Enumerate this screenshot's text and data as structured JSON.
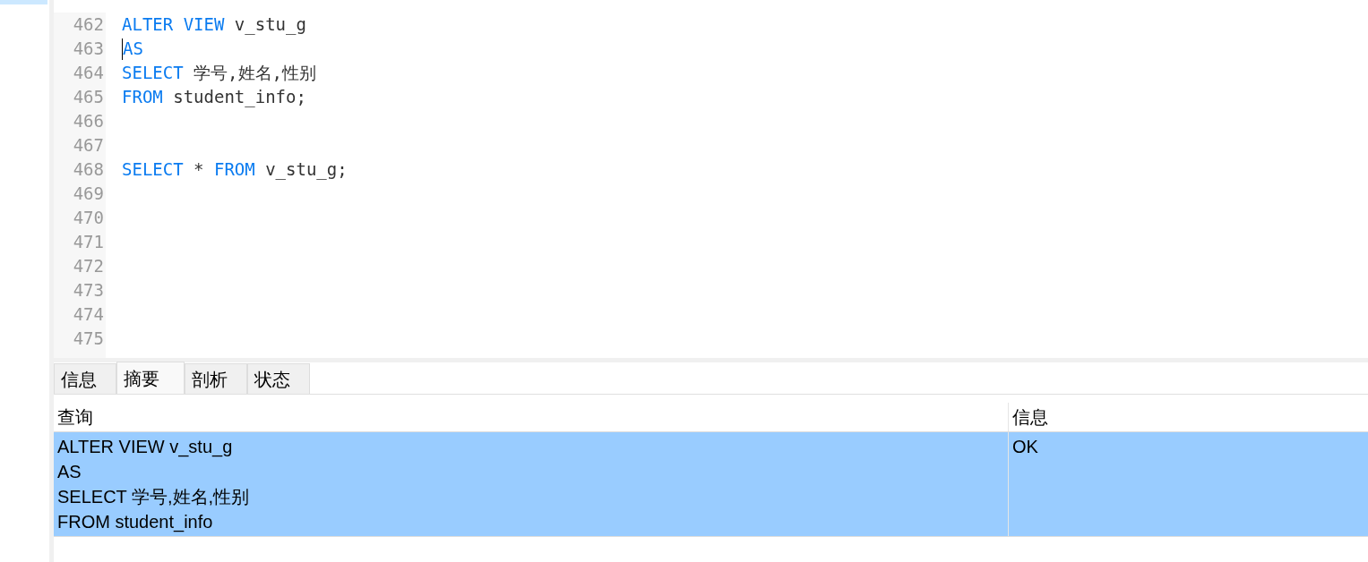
{
  "editor": {
    "lines": [
      {
        "number": "462",
        "tokens": [
          {
            "kind": "keyword",
            "text": "ALTER VIEW"
          },
          {
            "kind": "plain",
            "text": " v_stu_g"
          }
        ]
      },
      {
        "number": "463",
        "tokens": [
          {
            "kind": "cursor"
          },
          {
            "kind": "keyword",
            "text": "AS"
          }
        ]
      },
      {
        "number": "464",
        "tokens": [
          {
            "kind": "keyword",
            "text": "SELECT"
          },
          {
            "kind": "plain",
            "text": " 学号,姓名,性别"
          }
        ]
      },
      {
        "number": "465",
        "tokens": [
          {
            "kind": "keyword",
            "text": "FROM"
          },
          {
            "kind": "plain",
            "text": " student_info;"
          }
        ]
      },
      {
        "number": "466"
      },
      {
        "number": "467"
      },
      {
        "number": "468",
        "tokens": [
          {
            "kind": "keyword",
            "text": "SELECT"
          },
          {
            "kind": "plain",
            "text": " * "
          },
          {
            "kind": "keyword",
            "text": "FROM"
          },
          {
            "kind": "plain",
            "text": " v_stu_g;"
          }
        ]
      },
      {
        "number": "469"
      },
      {
        "number": "470"
      },
      {
        "number": "471"
      },
      {
        "number": "472"
      },
      {
        "number": "473"
      },
      {
        "number": "474"
      },
      {
        "number": "475"
      }
    ]
  },
  "result_tabs": [
    {
      "label": "信息",
      "selected": false
    },
    {
      "label": "摘要",
      "selected": true
    },
    {
      "label": "剖析",
      "selected": false
    },
    {
      "label": "状态",
      "selected": false
    }
  ],
  "summary_table": {
    "columns": [
      "查询",
      "信息"
    ],
    "rows": [
      {
        "selected": true,
        "query_lines": [
          "ALTER VIEW v_stu_g",
          "AS",
          "SELECT 学号,姓名,性别",
          "FROM student_info"
        ],
        "info": "OK"
      }
    ]
  }
}
